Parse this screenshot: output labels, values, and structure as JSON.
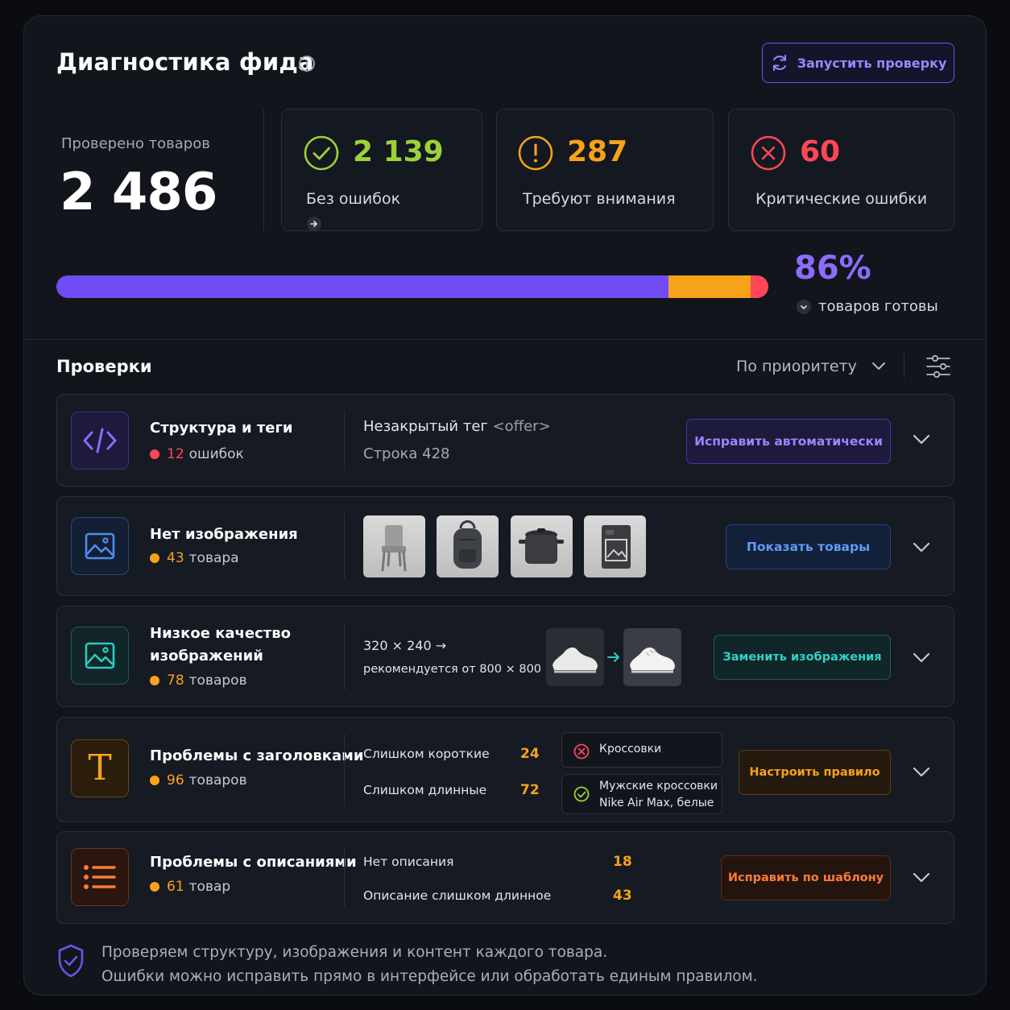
{
  "header": {
    "title": "Диагностика фида",
    "run_button": "Запустить проверку"
  },
  "summary": {
    "checked_label": "Проверено товаров",
    "checked_value": "2 486",
    "ok": {
      "value": "2 139",
      "label": "Без ошибок",
      "color": "#9bd23a"
    },
    "warn": {
      "value": "287",
      "label": "Требуют внимания",
      "color": "#f7a21b"
    },
    "crit": {
      "value": "60",
      "label": "Критические ошибки",
      "color": "#ff4658"
    }
  },
  "progress": {
    "segments": [
      {
        "name": "ok",
        "fraction": 0.86,
        "color": "#6f4cf6"
      },
      {
        "name": "warn",
        "fraction": 0.1155,
        "color": "#f7a21b"
      },
      {
        "name": "crit",
        "fraction": 0.0245,
        "color": "#ff4658"
      }
    ],
    "percent": "86%",
    "ready_label": "товаров готовы"
  },
  "checks": {
    "title": "Проверки",
    "sort_label": "По приоритету",
    "items": [
      {
        "title": "Структура и теги",
        "count": "12",
        "count_suffix": "ошибок",
        "dot_color": "#ff4658",
        "detail_main": "Незакрытый тег",
        "detail_tag": "<offer>",
        "detail_line": "Строка 428",
        "action": "Исправить автоматически"
      },
      {
        "title": "Нет изображения",
        "count": "43",
        "count_suffix": "товара",
        "dot_color": "#f7a21b",
        "action": "Показать товары"
      },
      {
        "title_line1": "Низкое качество",
        "title_line2": "изображений",
        "count": "78",
        "count_suffix": "товаров",
        "dot_color": "#f7a21b",
        "resolution": "320 × 240 →",
        "recommend": "рекомендуется от 800 × 800",
        "action": "Заменить изображения"
      },
      {
        "title": "Проблемы с заголовками",
        "count": "96",
        "count_suffix": "товаров",
        "dot_color": "#f7a21b",
        "row1_label": "Слишком короткие",
        "row1_value": "24",
        "row2_label": "Слишком длинные",
        "row2_value": "72",
        "bad_example": "Кроссовки",
        "good_example_line1": "Мужские кроссовки",
        "good_example_line2": "Nike Air Max, белые",
        "action": "Настроить правило"
      },
      {
        "title": "Проблемы с описаниями",
        "count": "61",
        "count_suffix": "товар",
        "dot_color": "#f7a21b",
        "row1_label": "Нет описания",
        "row1_value": "18",
        "row2_label": "Описание слишком длинное",
        "row2_value": "43",
        "action": "Исправить по шаблону"
      }
    ]
  },
  "footer": {
    "line1": "Проверяем структуру, изображения и контент каждого товара.",
    "line2": "Ошибки можно исправить прямо в интерфейсе или обработать единым правилом."
  }
}
